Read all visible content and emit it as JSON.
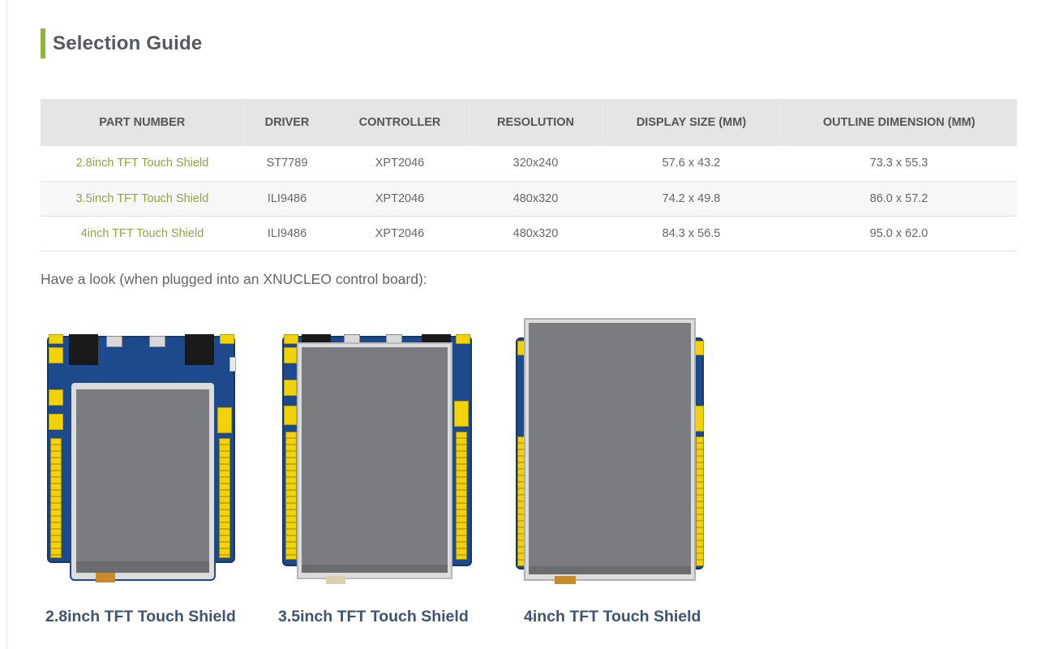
{
  "section": {
    "title": "Selection Guide",
    "accent_color": "#8db63c"
  },
  "table": {
    "headers": [
      "PART NUMBER",
      "DRIVER",
      "CONTROLLER",
      "RESOLUTION",
      "DISPLAY SIZE (MM)",
      "OUTLINE DIMENSION (MM)"
    ],
    "rows": [
      {
        "part": "2.8inch TFT Touch Shield",
        "driver": "ST7789",
        "controller": "XPT2046",
        "resolution": "320x240",
        "display_size": "57.6 x 43.2",
        "outline": "73.3 x 55.3"
      },
      {
        "part": "3.5inch TFT Touch Shield",
        "driver": "ILI9486",
        "controller": "XPT2046",
        "resolution": "480x320",
        "display_size": "74.2 x 49.8",
        "outline": "86.0 x 57.2"
      },
      {
        "part": "4inch TFT Touch Shield",
        "driver": "ILI9486",
        "controller": "XPT2046",
        "resolution": "480x320",
        "display_size": "84.3 x 56.5",
        "outline": "95.0 x 62.0"
      }
    ],
    "link_color": "#8aa844"
  },
  "intro_text": "Have a look (when plugged into an XNUCLEO control board):",
  "boards": [
    {
      "caption": "2.8inch TFT Touch Shield",
      "image": "2.8inch-shield-on-xnucleo"
    },
    {
      "caption": "3.5inch TFT Touch Shield",
      "image": "3.5inch-shield-on-xnucleo"
    },
    {
      "caption": "4inch TFT Touch Shield",
      "image": "4inch-shield-on-xnucleo"
    }
  ],
  "caption_color": "#3b5573"
}
